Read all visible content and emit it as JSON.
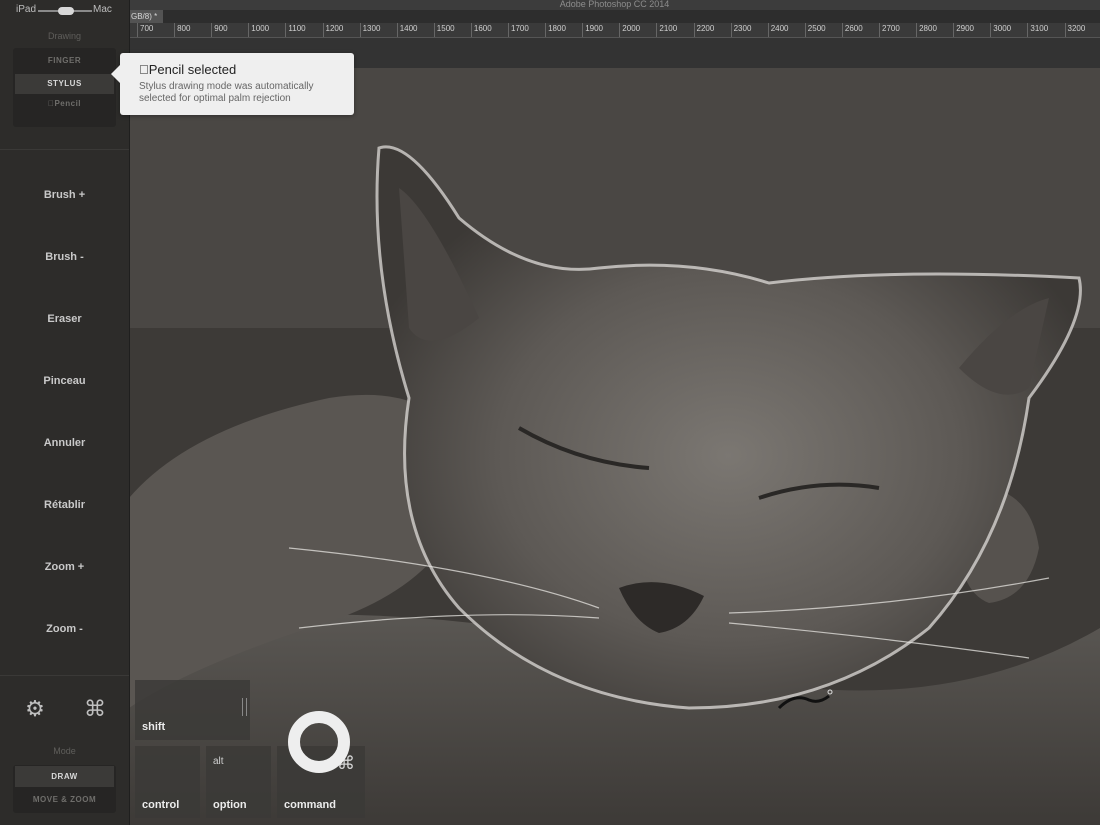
{
  "photoshop": {
    "title": "Adobe Photoshop CC 2014",
    "doc_tab": "GB/8) *",
    "ruler_labels": [
      "700",
      "800",
      "900",
      "1000",
      "1100",
      "1200",
      "1300",
      "1400",
      "1500",
      "1600",
      "1700",
      "1800",
      "1900",
      "2000",
      "2100",
      "2200",
      "2300",
      "2400",
      "2500",
      "2600",
      "2700",
      "2800",
      "2900",
      "3000",
      "3100",
      "3200"
    ]
  },
  "sidebar": {
    "device_switch": {
      "left": "iPad",
      "right": "Mac"
    },
    "drawing_label": "Drawing",
    "input_modes": [
      {
        "label": "FINGER",
        "active": false
      },
      {
        "label": "STYLUS",
        "active": true
      },
      {
        "label": "Pencil",
        "active": false
      }
    ],
    "tools": [
      "Brush +",
      "Brush -",
      "Eraser",
      "Pinceau",
      "Annuler",
      "Rétablir",
      "Zoom +",
      "Zoom -"
    ],
    "settings_icon": "gear-icon",
    "shortcuts_icon": "command-icon",
    "mode_label": "Mode",
    "modes": [
      {
        "label": "DRAW",
        "active": true
      },
      {
        "label": "MOVE & ZOOM",
        "active": false
      }
    ]
  },
  "tooltip": {
    "title": "Pencil selected",
    "body": "Stylus drawing mode was automatically selected for optimal palm rejection"
  },
  "keys": {
    "shift": "shift",
    "control": "control",
    "option": "option",
    "option_sub": "alt",
    "command": "command",
    "command_glyph": "⌘"
  },
  "colors": {
    "sidebar_bg": "#2d2c2a",
    "tooltip_bg": "#efefef",
    "active_mode": "#3b3a38"
  }
}
